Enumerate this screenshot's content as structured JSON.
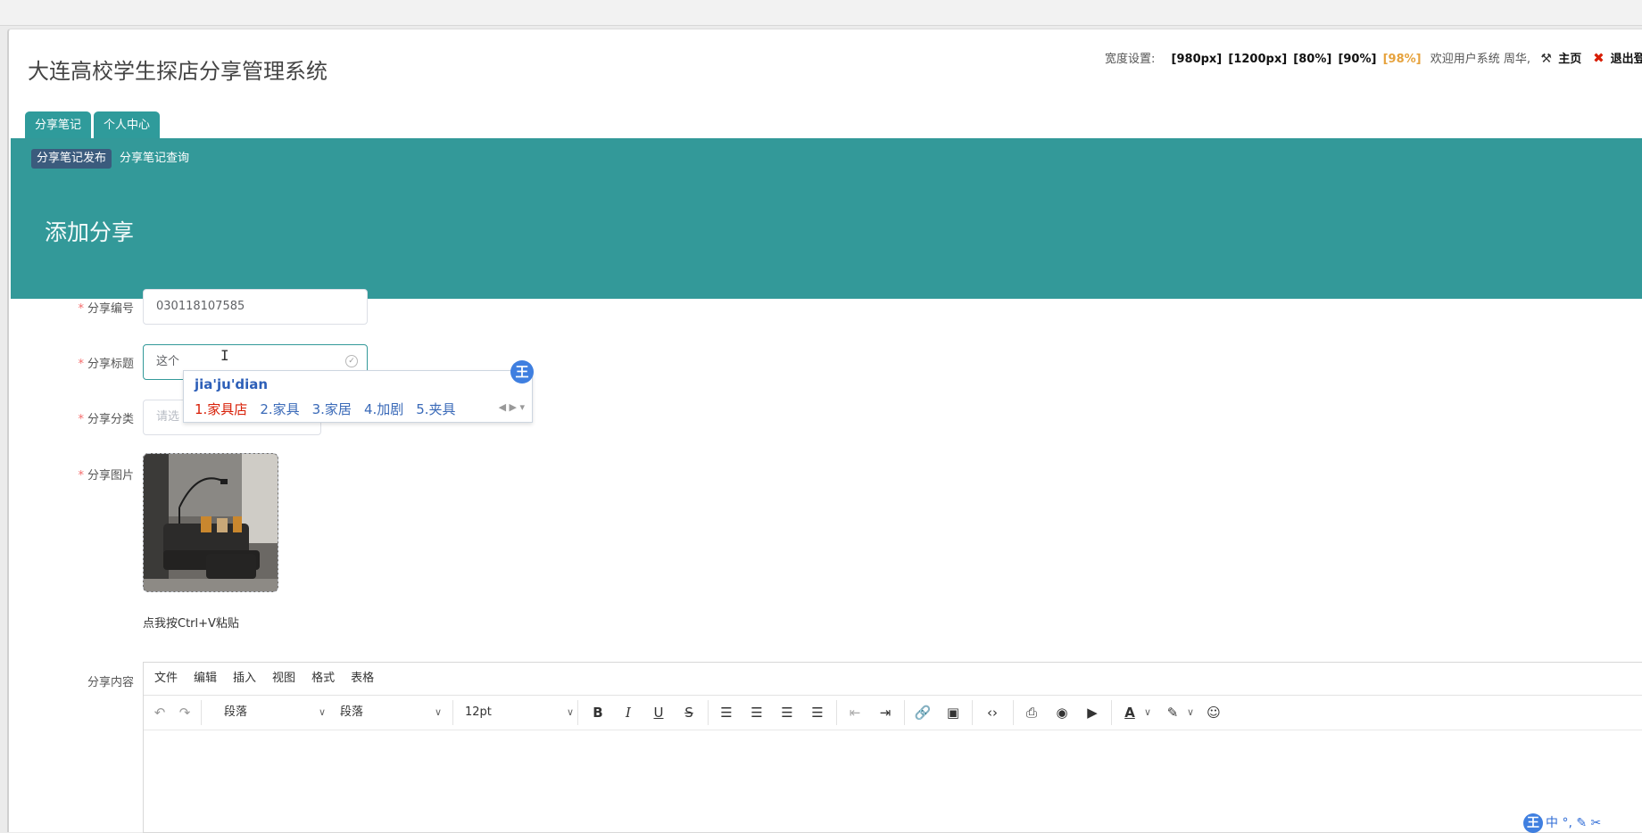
{
  "system": {
    "title": "大连高校学生探店分享管理系统"
  },
  "topbar": {
    "width_label": "宽度设置:",
    "width_options": [
      "[980px]",
      "[1200px]",
      "[80%]",
      "[90%]",
      "[98%]"
    ],
    "active_width": "[98%]",
    "welcome": "欢迎用户系统 周华,",
    "home": "主页",
    "logout": "退出登录"
  },
  "tabs": [
    {
      "label": "分享笔记"
    },
    {
      "label": "个人中心"
    }
  ],
  "subnav": [
    {
      "label": "分享笔记发布"
    },
    {
      "label": "分享笔记查询"
    }
  ],
  "section": {
    "title": "添加分享"
  },
  "form": {
    "id_label": "分享编号",
    "id_value": "030118107585",
    "title_label": "分享标题",
    "title_value": "这个",
    "category_label": "分享分类",
    "category_placeholder": "请选",
    "image_label": "分享图片",
    "paste_tip": "点我按Ctrl+V粘贴",
    "content_label": "分享内容"
  },
  "editor": {
    "menus": [
      "文件",
      "编辑",
      "插入",
      "视图",
      "格式",
      "表格"
    ],
    "block_format_1": "段落",
    "block_format_2": "段落",
    "font_size": "12pt",
    "icons": [
      "undo-icon",
      "redo-icon",
      "bold-icon",
      "italic-icon",
      "underline-icon",
      "strikethrough-icon",
      "align-left-icon",
      "align-center-icon",
      "align-right-icon",
      "align-justify-icon",
      "outdent-icon",
      "indent-icon",
      "link-icon",
      "image-icon",
      "code-icon",
      "print-icon",
      "preview-icon",
      "media-icon",
      "text-color-icon",
      "highlight-icon",
      "emoticon-icon"
    ]
  },
  "ime": {
    "pinyin": "jia'ju'dian",
    "candidates": [
      "1.家具店",
      "2.家具",
      "3.家居",
      "4.加剧",
      "5.夹具"
    ],
    "logo": "王"
  },
  "ime_status": {
    "logo": "王",
    "mode": "中"
  },
  "colors": {
    "teal": "#339999",
    "active_sub": "#3b5b7d",
    "required": "#f56c6c",
    "active_width": "#e6a23c"
  }
}
